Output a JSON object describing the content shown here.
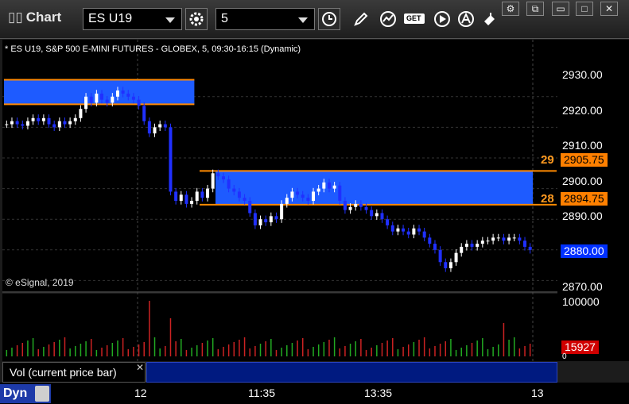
{
  "app": {
    "title": "Chart",
    "symbol": "ES U19",
    "interval": "5"
  },
  "toolbar": {
    "icons": [
      "settings-icon",
      "clock-icon",
      "pencil-icon",
      "line-chart-icon",
      "get-icon",
      "play-icon",
      "alert-icon",
      "eraser-icon"
    ],
    "get_label": "GET"
  },
  "window_controls": [
    "settings",
    "restore",
    "maximize",
    "close"
  ],
  "chart_data": {
    "type": "candlestick",
    "title": "* ES U19, S&P 500 E-MINI FUTURES - GLOBEX, 5, 09:30-16:15 (Dynamic)",
    "copyright": "© eSignal, 2019",
    "price_ticks": [
      "2930.00",
      "2920.00",
      "2910.00",
      "2900.00",
      "2890.00",
      "2880.00",
      "2870.00"
    ],
    "time_ticks": [
      "12",
      "11:35",
      "13:35",
      "13"
    ],
    "ylim": [
      2867,
      2946
    ],
    "current_price": "2880.00",
    "zone_upper_label": "2905.75",
    "zone_lower_label": "2894.75",
    "zone_upper_short": "29",
    "zone_lower_short": "28",
    "zones": [
      {
        "x_start": 0,
        "x_end": 36,
        "top": 2935.5,
        "bottom": 2927.5
      },
      {
        "x_start": 40,
        "x_end": 146,
        "top": 2905.75,
        "bottom": 2894.75
      }
    ],
    "candles_close": [
      2921,
      2922,
      2921,
      2920.5,
      2922,
      2923,
      2922,
      2923,
      2921,
      2920,
      2922,
      2921,
      2922,
      2923,
      2926,
      2930,
      2928,
      2931,
      2929,
      2928,
      2930,
      2932,
      2931,
      2930,
      2929,
      2927,
      2922,
      2918,
      2920,
      2921,
      2920,
      2899,
      2896,
      2898,
      2895,
      2896,
      2899,
      2897,
      2900,
      2905,
      2904,
      2903,
      2900,
      2899,
      2897,
      2896,
      2892,
      2888,
      2890,
      2889,
      2891,
      2890,
      2895,
      2897,
      2899,
      2898,
      2897,
      2896,
      2899,
      2900,
      2902,
      2900,
      2901,
      2896,
      2893,
      2894,
      2895,
      2894,
      2893,
      2891,
      2892,
      2890,
      2888,
      2886,
      2887,
      2886,
      2885,
      2887,
      2886,
      2884,
      2882,
      2880,
      2876,
      2874,
      2876,
      2879,
      2881,
      2882,
      2881,
      2882,
      2883,
      2883,
      2884,
      2884,
      2883,
      2884,
      2884,
      2883,
      2881,
      2880
    ],
    "volume": {
      "current": "15927",
      "scale_label": "100000",
      "zero_label": "0",
      "study_label": "Vol (current price bar)"
    },
    "grid": true
  },
  "footer": {
    "mode": "Dyn"
  }
}
